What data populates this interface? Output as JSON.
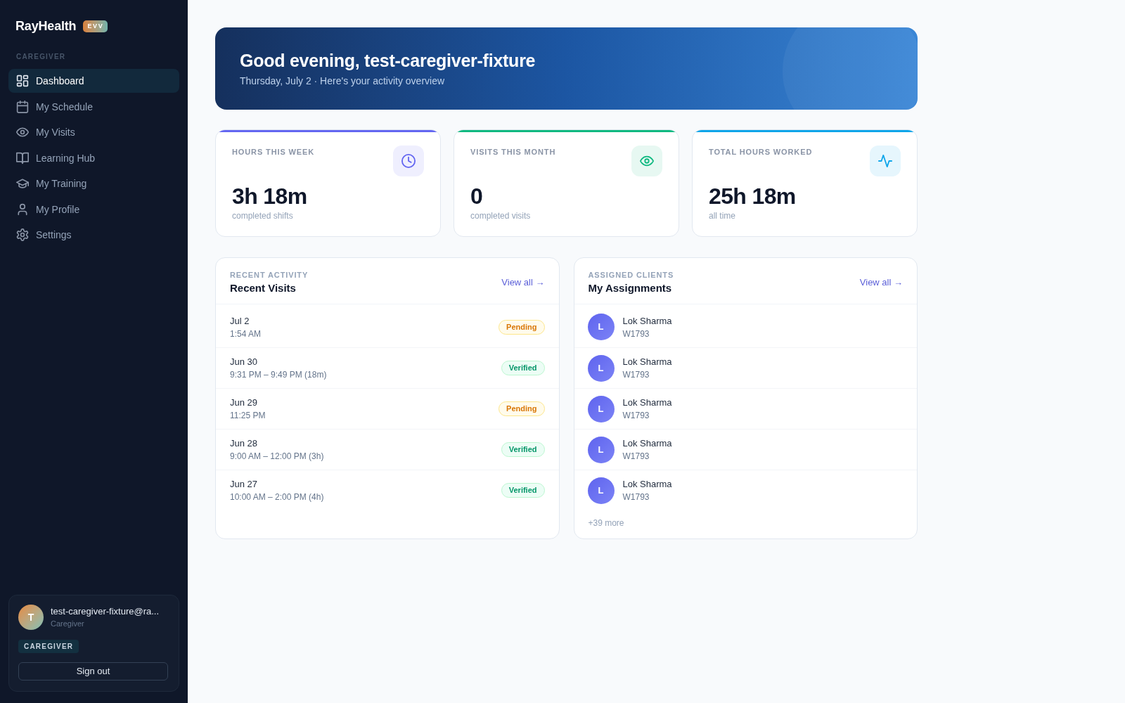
{
  "sidebar": {
    "brand": {
      "name": "RayHealth",
      "badge": "EVV"
    },
    "section_label": "CAREGIVER",
    "nav_items": [
      {
        "label": "Dashboard",
        "selected": true
      },
      {
        "label": "My Schedule",
        "selected": false
      },
      {
        "label": "My Visits",
        "selected": false
      },
      {
        "label": "Learning Hub",
        "selected": false
      },
      {
        "label": "My Training",
        "selected": false
      },
      {
        "label": "My Profile",
        "selected": false
      },
      {
        "label": "Settings",
        "selected": false
      }
    ],
    "user_card": {
      "avatar_initial": "T",
      "email": "test-caregiver-fixture@ra...",
      "role": "Caregiver",
      "role_badge": "CAREGIVER",
      "sign_out_button": "Sign out"
    }
  },
  "hero": {
    "title": "Good evening, test-caregiver-fixture",
    "subtitle": "Thursday, July 2 · Here's your activity overview"
  },
  "stats": [
    {
      "label": "HOURS THIS WEEK",
      "value": "3h 18m",
      "caption": "completed shifts",
      "color": "#6366f1"
    },
    {
      "label": "VISITS THIS MONTH",
      "value": "0",
      "caption": "completed visits",
      "color": "#10b981"
    },
    {
      "label": "TOTAL HOURS WORKED",
      "value": "25h 18m",
      "caption": "all time",
      "color": "#0ea5e9"
    }
  ],
  "recent_visits": {
    "kicker": "RECENT ACTIVITY",
    "title": "Recent Visits",
    "view_all_link": "View all →",
    "rows": [
      {
        "date": "Jul 2",
        "time": "1:54 AM",
        "kind": "pending",
        "badge": "Pending"
      },
      {
        "date": "Jun 30",
        "time": "9:31 PM – 9:49 PM (18m)",
        "kind": "verified",
        "badge": "Verified"
      },
      {
        "date": "Jun 29",
        "time": "11:25 PM",
        "kind": "pending",
        "badge": "Pending"
      },
      {
        "date": "Jun 28",
        "time": "9:00 AM – 12:00 PM (3h)",
        "kind": "verified",
        "badge": "Verified"
      },
      {
        "date": "Jun 27",
        "time": "10:00 AM – 2:00 PM (4h)",
        "kind": "verified",
        "badge": "Verified"
      }
    ]
  },
  "assignments": {
    "kicker": "ASSIGNED CLIENTS",
    "title": "My Assignments",
    "view_all_link": "View all →",
    "clients": [
      {
        "avatar_initial": "L",
        "name": "Lok Sharma",
        "id": "W1793"
      },
      {
        "avatar_initial": "L",
        "name": "Lok Sharma",
        "id": "W1793"
      },
      {
        "avatar_initial": "L",
        "name": "Lok Sharma",
        "id": "W1793"
      },
      {
        "avatar_initial": "L",
        "name": "Lok Sharma",
        "id": "W1793"
      },
      {
        "avatar_initial": "L",
        "name": "Lok Sharma",
        "id": "W1793"
      }
    ],
    "more": "+39 more"
  }
}
